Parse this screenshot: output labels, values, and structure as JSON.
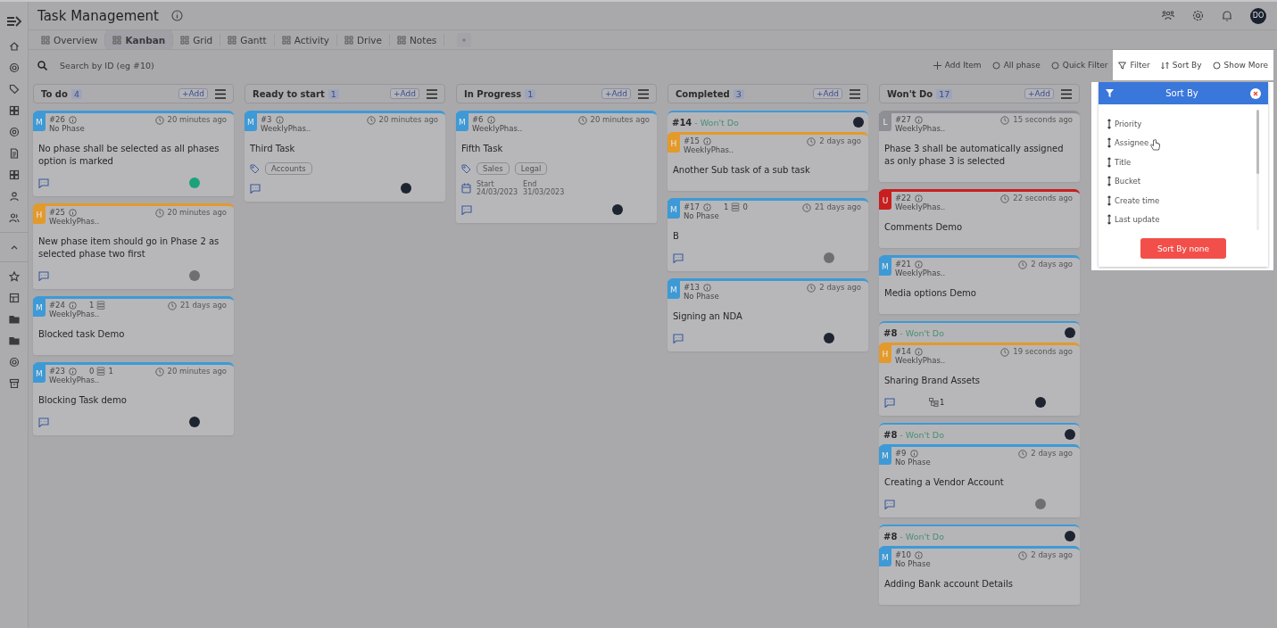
{
  "header": {
    "title": "Task Management",
    "user_initials": "DO"
  },
  "tabs": [
    {
      "label": "Overview",
      "selected": false
    },
    {
      "label": "Kanban",
      "selected": true
    },
    {
      "label": "Grid",
      "selected": false
    },
    {
      "label": "Gantt",
      "selected": false
    },
    {
      "label": "Activity",
      "selected": false
    },
    {
      "label": "Drive",
      "selected": false
    },
    {
      "label": "Notes",
      "selected": false
    }
  ],
  "search": {
    "placeholder": "Search by ID (eg #10)"
  },
  "toolbar": [
    {
      "label": "Add Item",
      "highlighted": false
    },
    {
      "label": "All phase",
      "highlighted": false
    },
    {
      "label": "Quick Filter",
      "highlighted": false
    },
    {
      "label": "Filter",
      "highlighted": true
    },
    {
      "label": "Sort By",
      "highlighted": true
    },
    {
      "label": "Show More",
      "highlighted": true
    }
  ],
  "columns": [
    {
      "name": "To do",
      "count": "4",
      "add": "+Add",
      "cards": [
        {
          "kind": "task",
          "priority": "M",
          "color": "#3d9ad6",
          "id": "#26",
          "phase": "No Phase",
          "time": "20 minutes ago",
          "title": "No phase shall be selected as all phases option is marked",
          "comment": true,
          "avatar": {
            "color": "#1aa37a"
          }
        },
        {
          "kind": "task",
          "priority": "H",
          "color": "#e39a2a",
          "id": "#25",
          "phase": "WeeklyPhas..",
          "time": "20 minutes ago",
          "title": "New phase item should go in Phase 2 as selected phase two first",
          "comment": true,
          "avatar": {
            "color": "#6f6f72"
          }
        },
        {
          "kind": "task",
          "priority": "M",
          "color": "#3d9ad6",
          "id": "#24",
          "phase": "WeeklyPhas..",
          "time": "21 days ago",
          "title": "Blocked task Demo",
          "dependency": {
            "blocked_by": "1"
          },
          "comment": false
        },
        {
          "kind": "task",
          "priority": "M",
          "color": "#3d9ad6",
          "id": "#23",
          "phase": "WeeklyPhas..",
          "time": "20 minutes ago",
          "title": "Blocking Task demo",
          "dependency": {
            "blocked_by": "0",
            "blocking": "1"
          },
          "comment": true,
          "avatar": {
            "color": "#1e2530"
          }
        }
      ]
    },
    {
      "name": "Ready to start",
      "count": "1",
      "add": "+Add",
      "cards": [
        {
          "kind": "task",
          "priority": "M",
          "color": "#3d9ad6",
          "id": "#3",
          "phase": "WeeklyPhas..",
          "time": "20 minutes ago",
          "title": "Third Task",
          "tags": [
            "Accounts"
          ],
          "comment": true,
          "avatar": {
            "color": "#1e2530"
          }
        }
      ]
    },
    {
      "name": "In Progress",
      "count": "1",
      "add": "+Add",
      "cards": [
        {
          "kind": "task",
          "priority": "M",
          "color": "#3d9ad6",
          "id": "#6",
          "phase": "WeeklyPhas..",
          "time": "20 minutes ago",
          "title": "Fifth Task",
          "tags": [
            "Sales",
            "Legal"
          ],
          "dates": {
            "start_label": "Start",
            "start": "24/03/2023",
            "end_label": "End",
            "end": "31/03/2023"
          },
          "comment": true,
          "avatar": {
            "color": "#1e2530"
          }
        }
      ]
    },
    {
      "name": "Completed",
      "count": "3",
      "add": "+Add",
      "cards": [
        {
          "kind": "group",
          "parent_id": "#14",
          "parent_status": "- Won't Do",
          "avatar": {
            "color": "#1e2530"
          },
          "card": {
            "priority": "H",
            "color": "#e39a2a",
            "id": "#15",
            "phase": "WeeklyPhas..",
            "time": "2 days ago",
            "title": "Another Sub task of a sub task",
            "comment": false
          }
        },
        {
          "kind": "task",
          "priority": "M",
          "color": "#3d9ad6",
          "id": "#17",
          "phase": "No Phase",
          "time": "21 days ago",
          "title": "B",
          "dependency": {
            "blocked_by": "1",
            "blocking": "0"
          },
          "comment": true,
          "avatar": {
            "color": "#6f6f72"
          }
        },
        {
          "kind": "task",
          "priority": "M",
          "color": "#3d9ad6",
          "id": "#13",
          "phase": "No Phase",
          "time": "2 days ago",
          "title": "Signing an NDA",
          "comment": true,
          "avatar": {
            "color": "#1e2530"
          }
        }
      ]
    },
    {
      "name": "Won't Do",
      "count": "17",
      "add": "+Add",
      "cards": [
        {
          "kind": "task",
          "priority": "L",
          "color": "#8e8e95",
          "id": "#27",
          "phase": "WeeklyPhas..",
          "time": "15 seconds ago",
          "title": "Phase 3 shall be automatically assigned as only phase 3 is selected",
          "comment": false
        },
        {
          "kind": "task",
          "priority": "U",
          "color": "#c81e1e",
          "id": "#22",
          "phase": "WeeklyPhas..",
          "time": "22 seconds ago",
          "title": "Comments Demo",
          "comment": false
        },
        {
          "kind": "task",
          "priority": "M",
          "color": "#3d9ad6",
          "id": "#21",
          "phase": "WeeklyPhas..",
          "time": "2 days ago",
          "title": "Media options Demo",
          "comment": false
        },
        {
          "kind": "group",
          "parent_id": "#8",
          "parent_status": "- Won't Do",
          "avatar": {
            "color": "#1e2530"
          },
          "card": {
            "priority": "H",
            "color": "#e39a2a",
            "id": "#14",
            "phase": "WeeklyPhas..",
            "time": "19 seconds ago",
            "title": "Sharing Brand Assets",
            "comment": true,
            "subtasks": "1",
            "avatar": {
              "color": "#1e2530"
            }
          }
        },
        {
          "kind": "group",
          "parent_id": "#8",
          "parent_status": "- Won't Do",
          "avatar": {
            "color": "#1e2530"
          },
          "card": {
            "priority": "M",
            "color": "#3d9ad6",
            "id": "#9",
            "phase": "No Phase",
            "time": "2 days ago",
            "title": "Creating a Vendor Account",
            "comment": true,
            "avatar": {
              "color": "#6f6f72"
            }
          }
        },
        {
          "kind": "group",
          "parent_id": "#8",
          "parent_status": "- Won't Do",
          "avatar": {
            "color": "#1e2530"
          },
          "card": {
            "priority": "M",
            "color": "#3d9ad6",
            "id": "#10",
            "phase": "No Phase",
            "time": "2 days ago",
            "title": "Adding Bank account Details",
            "comment": false
          }
        }
      ]
    }
  ],
  "sort_menu": {
    "title": "Sort By",
    "options": [
      "Priority",
      "Assignee",
      "Title",
      "Bucket",
      "Create time",
      "Last update"
    ],
    "reset": "Sort By none"
  }
}
